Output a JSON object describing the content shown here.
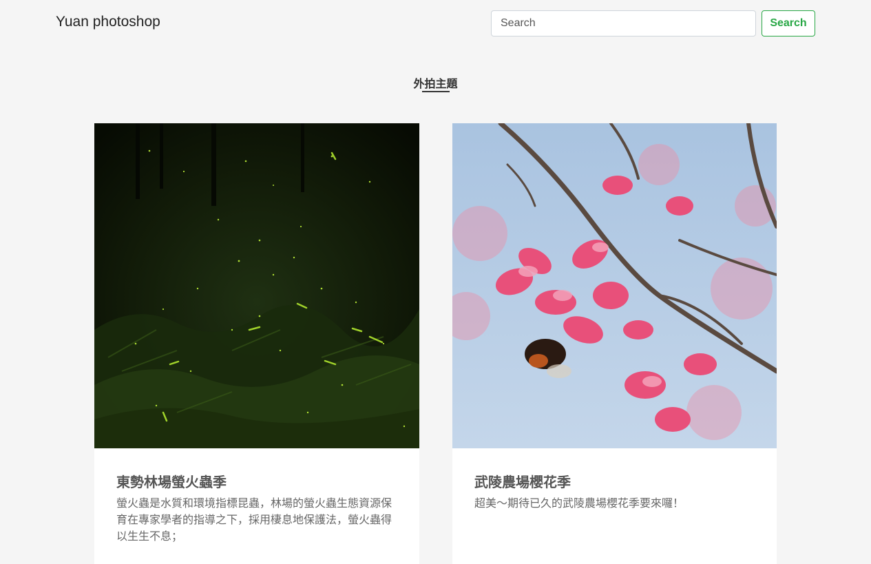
{
  "header": {
    "brand": "Yuan photoshop",
    "search_placeholder": "Search",
    "search_button": "Search",
    "accent_color": "#28a745"
  },
  "section": {
    "title": "外拍主題"
  },
  "cards": [
    {
      "title": "東勢林場螢火蟲季",
      "text": "螢火蟲是水質和環境指標昆蟲，林場的螢火蟲生態資源保育在專家學者的指導之下，採用棲息地保護法，螢火蟲得以生生不息；",
      "image": "fireflies-forest-photo"
    },
    {
      "title": "武陵農場櫻花季",
      "text": "超美～期待已久的武陵農場櫻花季要來囉！",
      "image": "cherry-blossom-bee-photo"
    }
  ]
}
